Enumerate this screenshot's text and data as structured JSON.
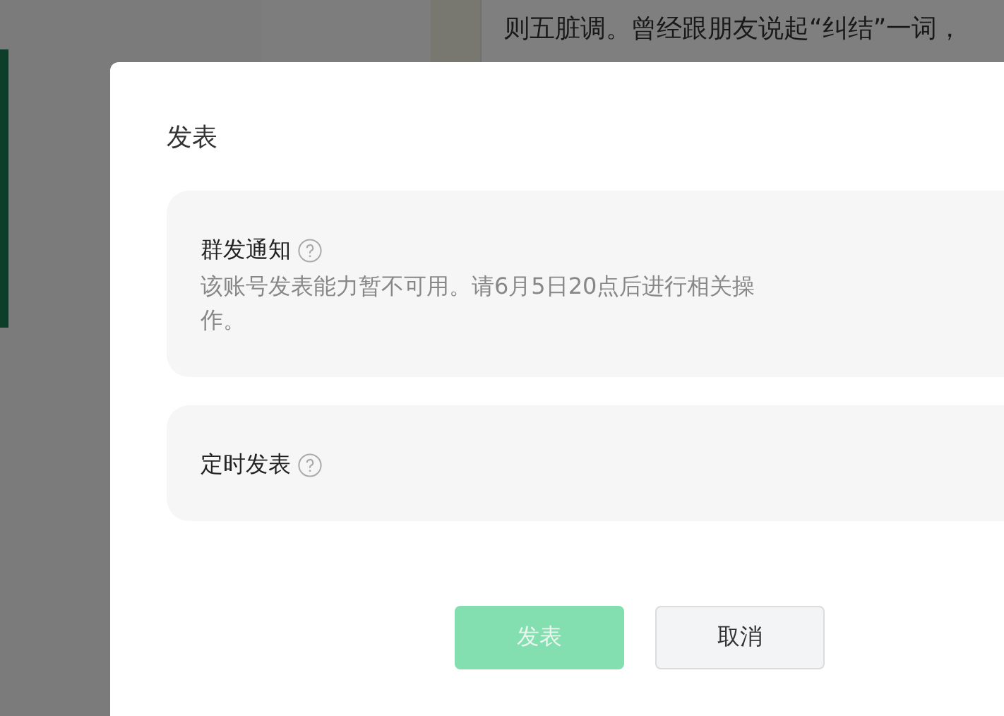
{
  "background": {
    "article_text": "则五脏调。曾经跟朋友说起“纠结”一词，"
  },
  "dialog": {
    "title": "发表",
    "options": [
      {
        "title": "群发通知",
        "notice": "该账号发表能力暂不可用。请6月5日20点后进行相关操作。"
      },
      {
        "title": "定时发表"
      }
    ],
    "buttons": [
      {
        "label": "发表",
        "kind": "primary",
        "disabled": true
      },
      {
        "label": "取消",
        "kind": "default",
        "disabled": false
      }
    ]
  }
}
